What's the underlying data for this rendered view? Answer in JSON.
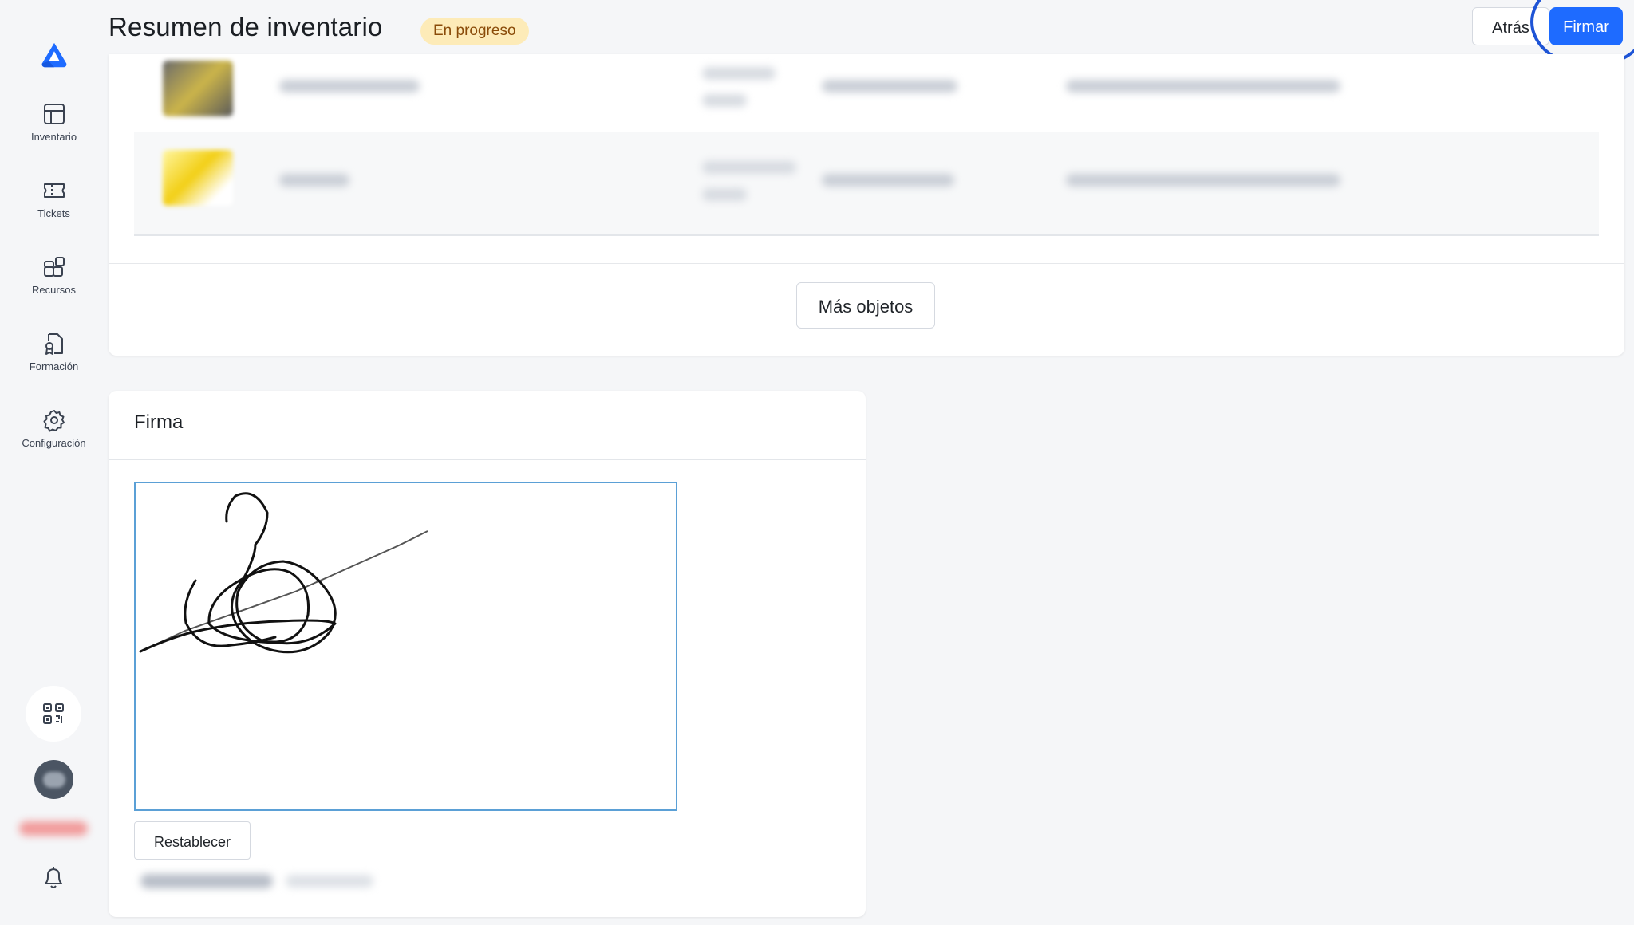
{
  "header": {
    "title": "Resumen de inventario",
    "status": "En progreso",
    "back_label": "Atrás",
    "sign_label": "Firmar"
  },
  "sidebar": {
    "logo": "app-logo",
    "items": [
      {
        "label": "Inventario",
        "icon": "table-icon"
      },
      {
        "label": "Tickets",
        "icon": "ticket-icon"
      },
      {
        "label": "Recursos",
        "icon": "resources-icon"
      },
      {
        "label": "Formación",
        "icon": "certificate-icon"
      },
      {
        "label": "Configuración",
        "icon": "gear-icon"
      }
    ],
    "bottom": {
      "qr": "qr-code-icon",
      "bell": "bell-icon"
    }
  },
  "items_card": {
    "more_label": "Más objetos"
  },
  "signature": {
    "title": "Firma",
    "reset_label": "Restablecer"
  },
  "colors": {
    "primary": "#1e6bff",
    "badge_bg": "#fdebb8",
    "badge_text": "#8a4b08",
    "pad_border": "#5ba0d6"
  }
}
